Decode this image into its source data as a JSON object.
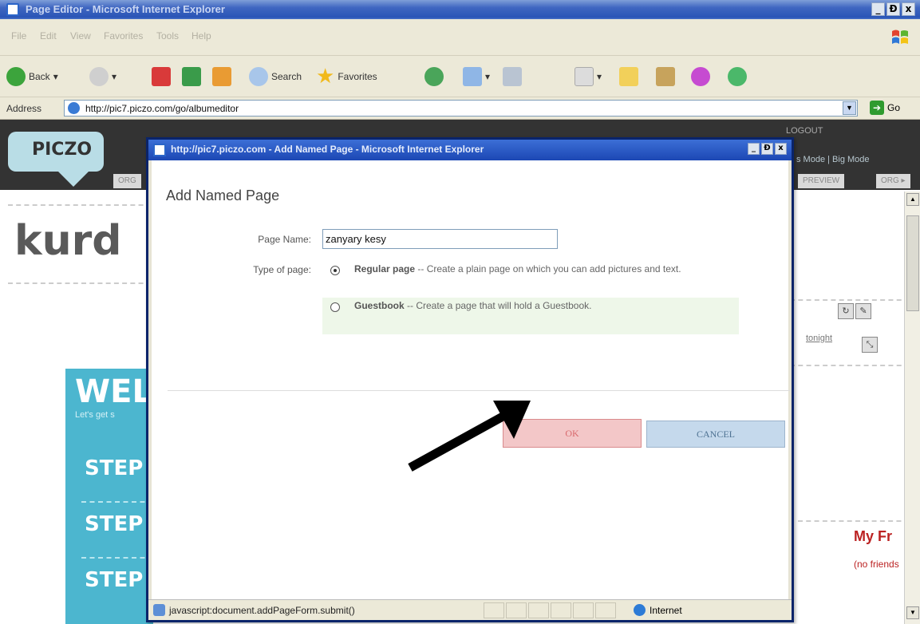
{
  "browser": {
    "title": "Page Editor - Microsoft Internet Explorer",
    "window_buttons": [
      "_",
      "Ɖ",
      "x"
    ],
    "menu": [
      "File",
      "Edit",
      "View",
      "Favorites",
      "Tools",
      "Help"
    ],
    "toolbar": {
      "back": "Back",
      "search": "Search",
      "favorites": "Favorites"
    },
    "address_label": "Address",
    "address_url": "http://pic7.piczo.com/go/albumeditor",
    "go_label": "Go"
  },
  "page": {
    "logo": "PICZO",
    "header_links": {
      "logout": "LOGOUT",
      "modes": "s Mode | Big Mode",
      "tab_org_left": "ORG",
      "tab_preview": "PREVIEW",
      "tab_org_right": "ORG ▸"
    },
    "site_title": "kurd",
    "tonight": "tonight",
    "welcome": {
      "title": "WELC",
      "subtitle": "Let's get s",
      "steps": [
        "STEP",
        "STEP",
        "STEP"
      ]
    },
    "friends_title": "My Fr",
    "friends_empty": "(no friends"
  },
  "dialog": {
    "title": "http://pic7.piczo.com - Add Named Page - Microsoft Internet Explorer",
    "heading": "Add Named Page",
    "page_name_label": "Page Name:",
    "page_name_value": "zanyary kesy",
    "type_label": "Type of page:",
    "types": [
      {
        "name": "Regular page",
        "desc": " -- Create a plain page on which you can add pictures and text.",
        "checked": true
      },
      {
        "name": "Guestbook",
        "desc": " -- Create a page that will hold a Guestbook.",
        "checked": false
      }
    ],
    "ok_label": "OK",
    "cancel_label": "CANCEL",
    "status_text": "javascript:document.addPageForm.submit()",
    "zone_text": "Internet"
  }
}
